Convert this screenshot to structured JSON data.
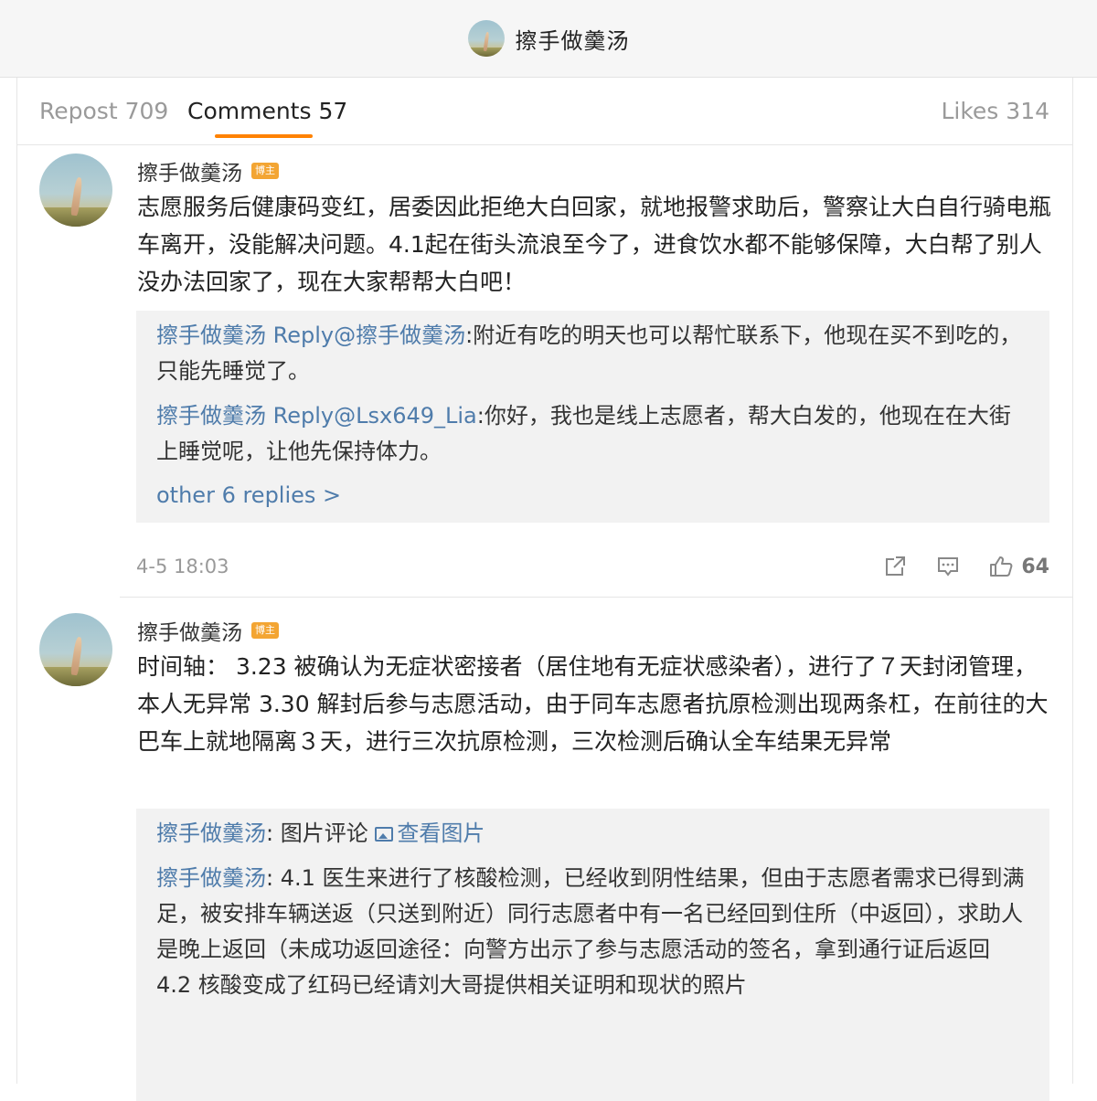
{
  "header": {
    "title": "擦手做羹汤"
  },
  "tabs": {
    "repost": "Repost 709",
    "comments": "Comments 57",
    "likes": "Likes 314"
  },
  "comments": [
    {
      "name": "擦手做羹汤",
      "badge": "博主",
      "body": "志愿服务后健康码变红，居委因此拒绝大白回家，就地报警求助后，警察让大白自行骑电瓶车离开，没能解决问题。4.1起在街头流浪至今了，进食饮水都不能够保障，大白帮了别人没办法回家了，现在大家帮帮大白吧！",
      "replies": [
        {
          "user": "擦手做羹汤",
          "prefix": " Reply@",
          "target": "擦手做羹汤",
          "colon": ":",
          "text": "附近有吃的明天也可以帮忙联系下，他现在买不到吃的，只能先睡觉了。"
        },
        {
          "user": "擦手做羹汤",
          "prefix": " Reply@",
          "target": "Lsx649_Lia",
          "colon": ":",
          "text": "你好，我也是线上志愿者，帮大白发的，他现在在大街上睡觉呢，让他先保持体力。"
        }
      ],
      "other_replies": "other 6 replies >",
      "time": "4-5 18:03",
      "like_count": "64"
    },
    {
      "name": "擦手做羹汤",
      "badge": "博主",
      "body": "时间轴：  3.23 被确认为无症状密接者（居住地有无症状感染者），进行了７天封闭管理，本人无异常 3.30 解封后参与志愿活动，由于同车志愿者抗原检测出现两条杠，在前往的大巴车上就地隔离３天，进行三次抗原检测，三次检测后确认全车结果无异常",
      "replies": [
        {
          "user": "擦手做羹汤",
          "colon": ":",
          "text": " 图片评论 ",
          "link": "查看图片"
        },
        {
          "user": "擦手做羹汤",
          "colon": ":",
          "text": " 4.1 医生来进行了核酸检测，已经收到阴性结果，但由于志愿者需求已得到满足，被安排车辆送返（只送到附近）同行志愿者中有一名已经回到住所（中返回），求助人是晚上返回（未成功返回途径：向警方出示了参与志愿活动的签名，拿到通行证后返回 4.2 核酸变成了红码已经请刘大哥提供相关证明和现状的照片"
        }
      ]
    }
  ],
  "colors": {
    "accent": "#ff8200",
    "link": "#4f7cab",
    "badge": "#f3a533"
  },
  "icons": [
    "share-icon",
    "comment-icon",
    "like-icon"
  ]
}
